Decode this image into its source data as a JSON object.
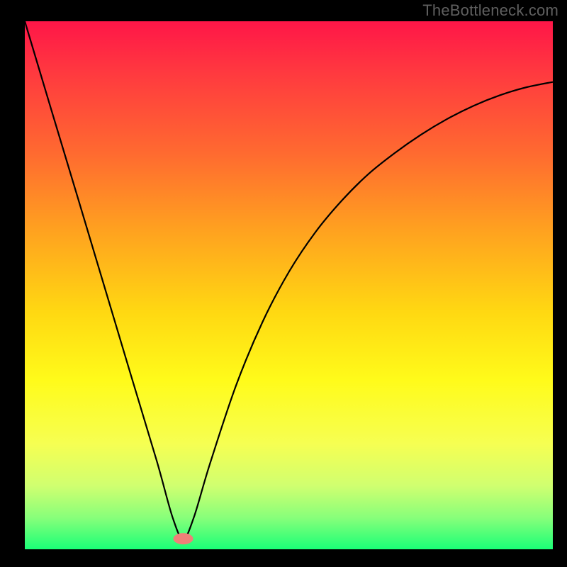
{
  "attribution": "TheBottleneck.com",
  "chart_data": {
    "type": "line",
    "title": "",
    "xlabel": "",
    "ylabel": "",
    "xlim": [
      0,
      1
    ],
    "ylim": [
      0,
      1
    ],
    "minimum_x": 0.3,
    "x": [
      0.0,
      0.05,
      0.1,
      0.15,
      0.2,
      0.25,
      0.28,
      0.3,
      0.32,
      0.35,
      0.4,
      0.45,
      0.5,
      0.55,
      0.6,
      0.65,
      0.7,
      0.75,
      0.8,
      0.85,
      0.9,
      0.95,
      1.0
    ],
    "values": [
      1.0,
      0.833,
      0.667,
      0.5,
      0.333,
      0.167,
      0.06,
      0.02,
      0.06,
      0.16,
      0.31,
      0.43,
      0.525,
      0.6,
      0.66,
      0.71,
      0.75,
      0.785,
      0.815,
      0.84,
      0.86,
      0.875,
      0.885
    ],
    "marker": {
      "x": 0.3,
      "y": 0.02,
      "color": "#f08078"
    },
    "gradient_stops": [
      {
        "offset": 0.0,
        "color": "#ff1648"
      },
      {
        "offset": 0.1,
        "color": "#ff3a3f"
      },
      {
        "offset": 0.25,
        "color": "#ff6a30"
      },
      {
        "offset": 0.4,
        "color": "#ffa31f"
      },
      {
        "offset": 0.55,
        "color": "#ffd812"
      },
      {
        "offset": 0.68,
        "color": "#fffb1a"
      },
      {
        "offset": 0.8,
        "color": "#f6ff52"
      },
      {
        "offset": 0.88,
        "color": "#d0ff70"
      },
      {
        "offset": 0.94,
        "color": "#88ff7a"
      },
      {
        "offset": 1.0,
        "color": "#1aff77"
      }
    ]
  }
}
